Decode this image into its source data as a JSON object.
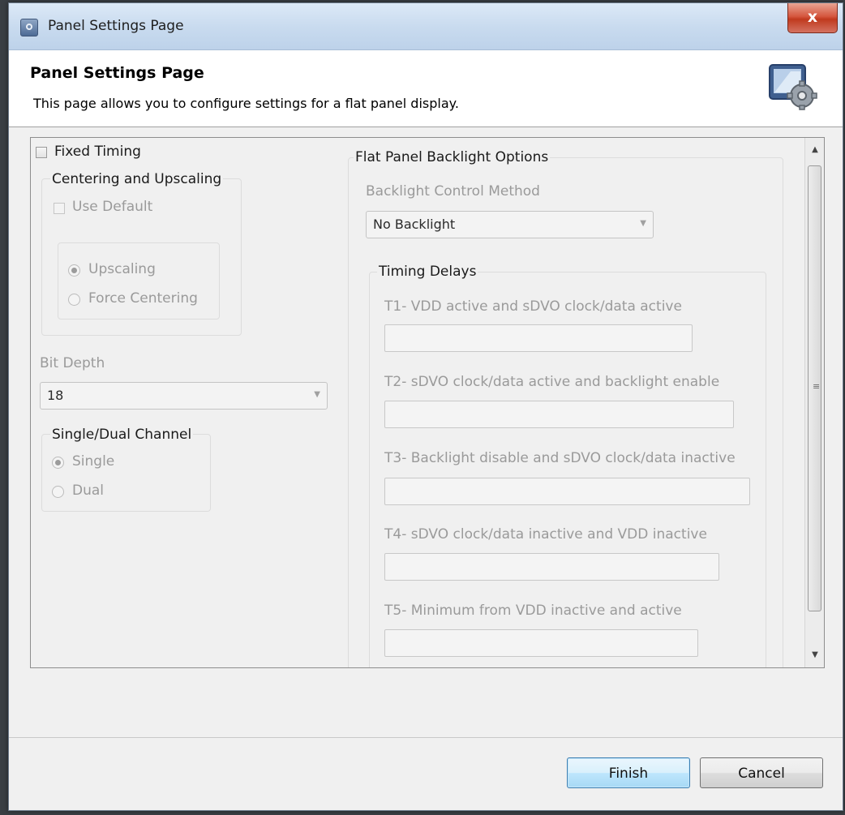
{
  "window": {
    "title": "Panel Settings Page",
    "close_label": "x"
  },
  "header": {
    "title": "Panel Settings Page",
    "description": "This page allows you to configure settings for a flat panel display."
  },
  "left": {
    "fixed_timing": {
      "label": "Fixed Timing",
      "checked": false
    },
    "centering_group": {
      "title": "Centering and Upscaling",
      "use_default": {
        "label": "Use Default",
        "checked": false
      },
      "options": [
        {
          "label": "Upscaling",
          "selected": true
        },
        {
          "label": "Force Centering",
          "selected": false
        }
      ]
    },
    "bit_depth": {
      "label": "Bit Depth",
      "value": "18"
    },
    "channel_group": {
      "title": "Single/Dual Channel",
      "options": [
        {
          "label": "Single",
          "selected": true
        },
        {
          "label": "Dual",
          "selected": false
        }
      ]
    }
  },
  "right": {
    "backlight_group": {
      "title": "Flat Panel Backlight Options",
      "method_label": "Backlight Control Method",
      "method_value": "No Backlight"
    },
    "timing_group": {
      "title": "Timing Delays",
      "fields": [
        {
          "label": "T1- VDD active and sDVO clock/data active",
          "value": ""
        },
        {
          "label": "T2- sDVO clock/data active and backlight enable",
          "value": ""
        },
        {
          "label": "T3- Backlight disable and sDVO clock/data inactive",
          "value": ""
        },
        {
          "label": "T4- sDVO clock/data inactive and VDD inactive",
          "value": ""
        },
        {
          "label": "T5- Minimum from VDD inactive and active",
          "value": ""
        }
      ]
    }
  },
  "footer": {
    "finish_label": "Finish",
    "cancel_label": "Cancel"
  }
}
